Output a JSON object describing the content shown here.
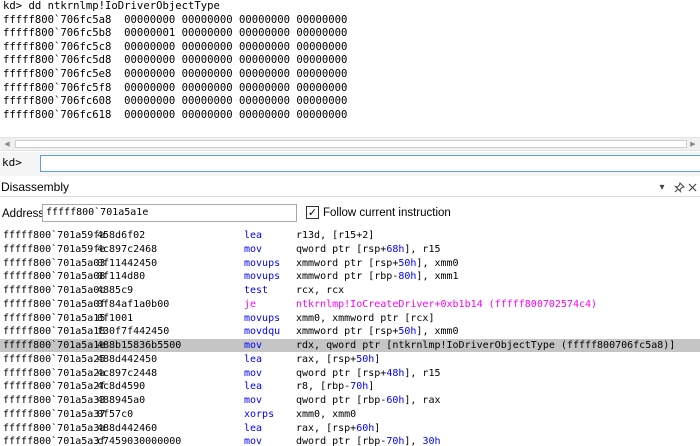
{
  "command_window": {
    "lines": [
      "kd> dd ntkrnlmp!IoDriverObjectType",
      "fffff800`706fc5a8  00000000 00000000 00000000 00000000",
      "fffff800`706fc5b8  00000001 00000000 00000000 00000000",
      "fffff800`706fc5c8  00000000 00000000 00000000 00000000",
      "fffff800`706fc5d8  00000000 00000000 00000000 00000000",
      "fffff800`706fc5e8  00000000 00000000 00000000 00000000",
      "fffff800`706fc5f8  00000000 00000000 00000000 00000000",
      "fffff800`706fc608  00000000 00000000 00000000 00000000",
      "fffff800`706fc618  00000000 00000000 00000000 00000000"
    ],
    "prompt": "kd>",
    "input_value": ""
  },
  "disassembly": {
    "title": "Disassembly",
    "pin_icon": "pin-icon",
    "dropdown_icon": "chevron-down-icon",
    "address_label": "Address:",
    "address_value": "fffff800`701a5a1e",
    "follow_label": "Follow current instruction",
    "follow_checked": true,
    "colors": {
      "mnemonic": "#0000ff",
      "jump": "#ff00ff",
      "register_highlight": "#0000ff",
      "selected_row": "#c5c5c5"
    },
    "rows": [
      {
        "addr": "fffff800`701a59fa",
        "bytes": "458d6f02",
        "mn": "lea",
        "ops": [
          {
            "t": "r13d, [r15+2]"
          }
        ]
      },
      {
        "addr": "fffff800`701a59fe",
        "bytes": "4c897c2468",
        "mn": "mov",
        "ops": [
          {
            "t": "qword ptr [rsp+"
          },
          {
            "t": "68h",
            "hl": true
          },
          {
            "t": "], r15"
          }
        ]
      },
      {
        "addr": "fffff800`701a5a03",
        "bytes": "0f11442450",
        "mn": "movups",
        "ops": [
          {
            "t": "xmmword ptr [rsp+"
          },
          {
            "t": "50h",
            "hl": true
          },
          {
            "t": "], xmm0"
          }
        ]
      },
      {
        "addr": "fffff800`701a5a08",
        "bytes": "0f114d80",
        "mn": "movups",
        "ops": [
          {
            "t": "xmmword ptr [rbp-"
          },
          {
            "t": "80h",
            "hl": true
          },
          {
            "t": "], xmm1"
          }
        ]
      },
      {
        "addr": "fffff800`701a5a0c",
        "bytes": "4885c9",
        "mn": "test",
        "ops": [
          {
            "t": "rcx, rcx"
          }
        ]
      },
      {
        "addr": "fffff800`701a5a0f",
        "bytes": "0f84af1a0b00",
        "mn": "je",
        "jump": true,
        "ops": [
          {
            "t": "ntkrnlmp!IoCreateDriver+0xb1b14 (fffff800702574c4)"
          }
        ]
      },
      {
        "addr": "fffff800`701a5a15",
        "bytes": "0f1001",
        "mn": "movups",
        "ops": [
          {
            "t": "xmm0, xmmword ptr [rcx]"
          }
        ]
      },
      {
        "addr": "fffff800`701a5a18",
        "bytes": "f30f7f442450",
        "mn": "movdqu",
        "ops": [
          {
            "t": "xmmword ptr [rsp+"
          },
          {
            "t": "50h",
            "hl": true
          },
          {
            "t": "], xmm0"
          }
        ]
      },
      {
        "addr": "fffff800`701a5a1e",
        "bytes": "488b15836b5500",
        "mn": "mov",
        "selected": true,
        "ops": [
          {
            "t": "rdx, qword ptr [ntkrnlmp!IoDriverObjectType (fffff800706fc5a8)]"
          }
        ]
      },
      {
        "addr": "fffff800`701a5a25",
        "bytes": "488d442450",
        "mn": "lea",
        "ops": [
          {
            "t": "rax, [rsp+"
          },
          {
            "t": "50h",
            "hl": true
          },
          {
            "t": "]"
          }
        ]
      },
      {
        "addr": "fffff800`701a5a2a",
        "bytes": "4c897c2448",
        "mn": "mov",
        "ops": [
          {
            "t": "qword ptr [rsp+"
          },
          {
            "t": "48h",
            "hl": true
          },
          {
            "t": "], r15"
          }
        ]
      },
      {
        "addr": "fffff800`701a5a2f",
        "bytes": "4c8d4590",
        "mn": "lea",
        "ops": [
          {
            "t": "r8, [rbp-"
          },
          {
            "t": "70h",
            "hl": true
          },
          {
            "t": "]"
          }
        ]
      },
      {
        "addr": "fffff800`701a5a33",
        "bytes": "488945a0",
        "mn": "mov",
        "ops": [
          {
            "t": "qword ptr [rbp-"
          },
          {
            "t": "60h",
            "hl": true
          },
          {
            "t": "], rax"
          }
        ]
      },
      {
        "addr": "fffff800`701a5a37",
        "bytes": "0f57c0",
        "mn": "xorps",
        "ops": [
          {
            "t": "xmm0, xmm0"
          }
        ]
      },
      {
        "addr": "fffff800`701a5a3a",
        "bytes": "488d442460",
        "mn": "lea",
        "ops": [
          {
            "t": "rax, [rsp+"
          },
          {
            "t": "60h",
            "hl": true
          },
          {
            "t": "]"
          }
        ]
      },
      {
        "addr": "fffff800`701a5a3f",
        "bytes": "c7459030000000",
        "mn": "mov",
        "ops": [
          {
            "t": "dword ptr [rbp-"
          },
          {
            "t": "70h",
            "hl": true
          },
          {
            "t": "], "
          },
          {
            "t": "30h",
            "hl": true
          }
        ]
      }
    ]
  }
}
